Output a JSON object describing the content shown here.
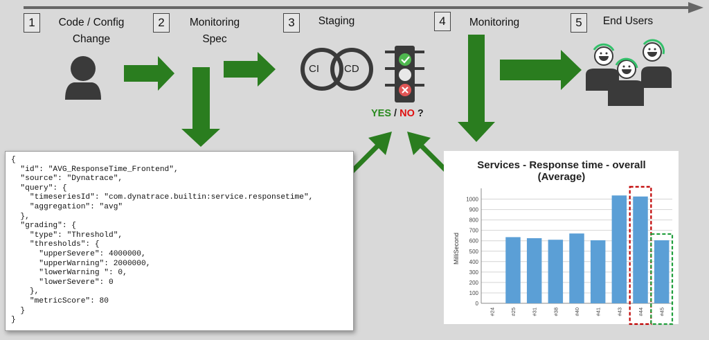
{
  "steps": [
    {
      "num": "1",
      "label": "Code / Config\nChange"
    },
    {
      "num": "2",
      "label": "Monitoring\nSpec"
    },
    {
      "num": "3",
      "label": "Staging"
    },
    {
      "num": "4",
      "label": "Monitoring"
    },
    {
      "num": "5",
      "label": "End Users"
    }
  ],
  "ci_label": "CI",
  "cd_label": "CD",
  "verdict": {
    "yes": "YES",
    "sep": "/",
    "no": "NO",
    "q": "?"
  },
  "colors": {
    "arrow": "#2a7d1f",
    "yes": "#2a8a1f",
    "no": "#e01010",
    "bar": "#5b9fd6",
    "red_box": "#c00000",
    "green_box": "#1e9e3a"
  },
  "spec_lines": [
    "{",
    "  \"id\": \"AVG_ResponseTime_Frontend\",",
    "  \"source\": \"Dynatrace\",",
    "  \"query\": {",
    "    \"timeseriesId\": \"com.dynatrace.builtin:service.responsetime\",",
    "    \"aggregation\": \"avg\"",
    "  },",
    "  \"grading\": {",
    "    \"type\": \"Threshold\",",
    "    \"thresholds\": {",
    "      \"upperSevere\": 4000000,",
    "      \"upperWarning\": 2000000,",
    "      \"lowerWarning \": 0,",
    "      \"lowerSevere\": 0",
    "    },",
    "    \"metricScore\": 80",
    "  }",
    "}"
  ],
  "chart_data": {
    "type": "bar",
    "title": "Services - Response time - overall",
    "subtitle": "(Average)",
    "ylabel": "MilliSecond",
    "xlabel": "",
    "categories": [
      "#24",
      "#25",
      "#31",
      "#38",
      "#40",
      "#41",
      "#43",
      "#44",
      "#45"
    ],
    "values": [
      null,
      635,
      625,
      610,
      670,
      605,
      1035,
      1025,
      605
    ],
    "ylim": [
      0,
      1050
    ],
    "yticks": [
      0,
      100,
      200,
      300,
      400,
      500,
      600,
      700,
      800,
      900,
      1000
    ],
    "grid": true,
    "highlight_red": "#44",
    "highlight_green": "#45"
  }
}
